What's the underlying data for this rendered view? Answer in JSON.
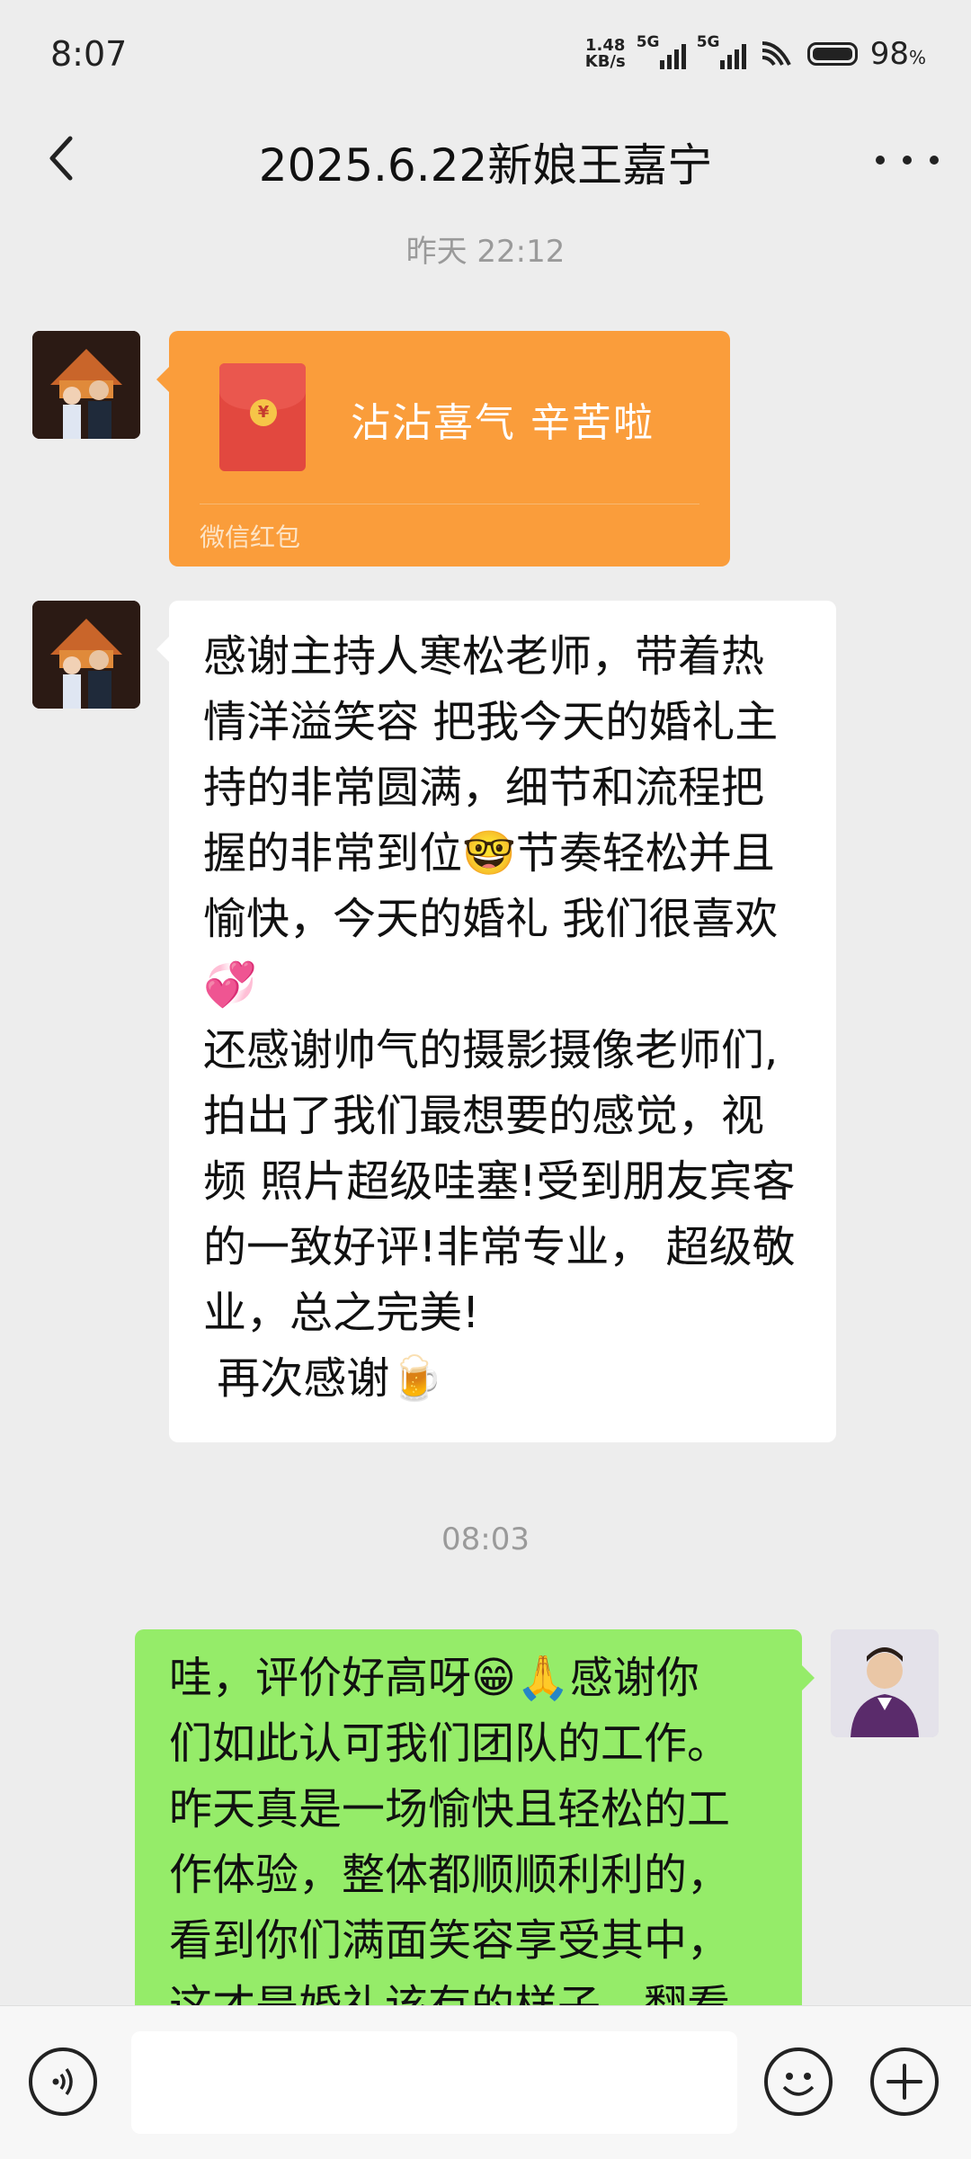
{
  "status_bar": {
    "time": "8:07",
    "net_speed_top": "1.48",
    "net_speed_bottom": "KB/s",
    "signal1": "5G",
    "signal2": "5G",
    "battery": "98",
    "battery_unit": "%"
  },
  "nav": {
    "title": "2025.6.22新娘王嘉宁"
  },
  "chat": {
    "time1": "昨天 22:12",
    "red_packet": {
      "text": "沾沾喜气  辛苦啦",
      "footer": "微信红包"
    },
    "msg1": "感谢主持人寒松老师，带着热\n情洋溢笑容 把我今天的婚礼主\n持的非常圆满，细节和流程把\n握的非常到位🤓节奏轻松并且\n愉快，今天的婚礼 我们很喜欢\n💞\n还感谢帅气的摄影摄像老师们,\n拍出了我们最想要的感觉，视\n频 照片超级哇塞!受到朋友宾客\n的一致好评!非常专业， 超级敬\n业，总之完美!\n 再次感谢🍺",
    "time2": "08:03",
    "msg2": "哇，评价好高呀😁🙏感谢你\n们如此认可我们团队的工作。\n昨天真是一场愉快且轻松的工\n作体验，整体都顺顺利利的，\n看到你们满面笑容享受其中，\n这才是婚礼该有的样子。翻看"
  },
  "input": {
    "placeholder": ""
  }
}
